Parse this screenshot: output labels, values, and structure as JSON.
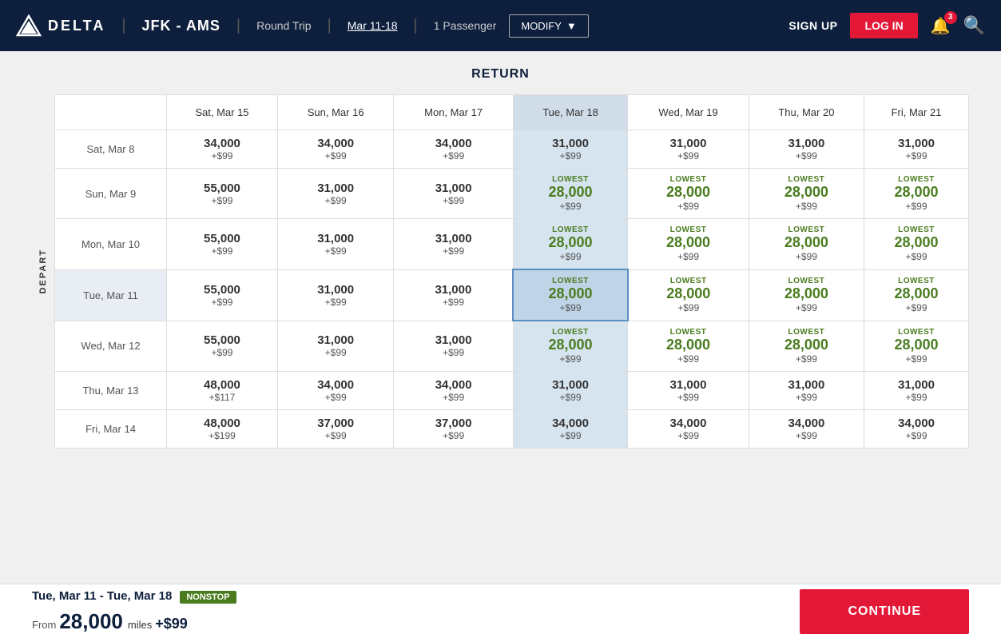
{
  "header": {
    "logo_text": "DELTA",
    "route": "JFK - AMS",
    "divider1": "|",
    "trip_type": "Round Trip",
    "divider2": "|",
    "dates": "Mar 11-18",
    "divider3": "|",
    "passengers": "1 Passenger",
    "modify_label": "MODIFY",
    "signup_label": "SIGN UP",
    "login_label": "LOG IN",
    "notif_count": "3"
  },
  "section_title": "RETURN",
  "depart_label": "DEPART",
  "columns": [
    {
      "id": "empty",
      "label": ""
    },
    {
      "id": "sat_mar15",
      "label": "Sat, Mar 15",
      "selected": false
    },
    {
      "id": "sun_mar16",
      "label": "Sun, Mar 16",
      "selected": false
    },
    {
      "id": "mon_mar17",
      "label": "Mon, Mar 17",
      "selected": false
    },
    {
      "id": "tue_mar18",
      "label": "Tue, Mar 18",
      "selected": true
    },
    {
      "id": "wed_mar19",
      "label": "Wed, Mar 19",
      "selected": false
    },
    {
      "id": "thu_mar20",
      "label": "Thu, Mar 20",
      "selected": false
    },
    {
      "id": "fri_mar21",
      "label": "Fri, Mar 21",
      "selected": false
    }
  ],
  "rows": [
    {
      "id": "sat_mar8",
      "label": "Sat, Mar 8",
      "selected": false,
      "cells": [
        {
          "miles": "34,000",
          "fee": "+$99",
          "lowest": false
        },
        {
          "miles": "34,000",
          "fee": "+$99",
          "lowest": false
        },
        {
          "miles": "34,000",
          "fee": "+$99",
          "lowest": false
        },
        {
          "miles": "31,000",
          "fee": "+$99",
          "lowest": false
        },
        {
          "miles": "31,000",
          "fee": "+$99",
          "lowest": false
        },
        {
          "miles": "31,000",
          "fee": "+$99",
          "lowest": false
        },
        {
          "miles": "31,000",
          "fee": "+$99",
          "lowest": false
        }
      ]
    },
    {
      "id": "sun_mar9",
      "label": "Sun, Mar 9",
      "selected": false,
      "cells": [
        {
          "miles": "55,000",
          "fee": "+$99",
          "lowest": false
        },
        {
          "miles": "31,000",
          "fee": "+$99",
          "lowest": false
        },
        {
          "miles": "31,000",
          "fee": "+$99",
          "lowest": false
        },
        {
          "miles": "28,000",
          "fee": "+$99",
          "lowest": true
        },
        {
          "miles": "28,000",
          "fee": "+$99",
          "lowest": true
        },
        {
          "miles": "28,000",
          "fee": "+$99",
          "lowest": true
        },
        {
          "miles": "28,000",
          "fee": "+$99",
          "lowest": true
        }
      ]
    },
    {
      "id": "mon_mar10",
      "label": "Mon, Mar 10",
      "selected": false,
      "cells": [
        {
          "miles": "55,000",
          "fee": "+$99",
          "lowest": false
        },
        {
          "miles": "31,000",
          "fee": "+$99",
          "lowest": false
        },
        {
          "miles": "31,000",
          "fee": "+$99",
          "lowest": false
        },
        {
          "miles": "28,000",
          "fee": "+$99",
          "lowest": true
        },
        {
          "miles": "28,000",
          "fee": "+$99",
          "lowest": true
        },
        {
          "miles": "28,000",
          "fee": "+$99",
          "lowest": true
        },
        {
          "miles": "28,000",
          "fee": "+$99",
          "lowest": true
        }
      ]
    },
    {
      "id": "tue_mar11",
      "label": "Tue, Mar 11",
      "selected": true,
      "cells": [
        {
          "miles": "55,000",
          "fee": "+$99",
          "lowest": false
        },
        {
          "miles": "31,000",
          "fee": "+$99",
          "lowest": false
        },
        {
          "miles": "31,000",
          "fee": "+$99",
          "lowest": false
        },
        {
          "miles": "28,000",
          "fee": "+$99",
          "lowest": true,
          "selected": true
        },
        {
          "miles": "28,000",
          "fee": "+$99",
          "lowest": true
        },
        {
          "miles": "28,000",
          "fee": "+$99",
          "lowest": true
        },
        {
          "miles": "28,000",
          "fee": "+$99",
          "lowest": true
        }
      ]
    },
    {
      "id": "wed_mar12",
      "label": "Wed, Mar 12",
      "selected": false,
      "cells": [
        {
          "miles": "55,000",
          "fee": "+$99",
          "lowest": false
        },
        {
          "miles": "31,000",
          "fee": "+$99",
          "lowest": false
        },
        {
          "miles": "31,000",
          "fee": "+$99",
          "lowest": false
        },
        {
          "miles": "28,000",
          "fee": "+$99",
          "lowest": true
        },
        {
          "miles": "28,000",
          "fee": "+$99",
          "lowest": true
        },
        {
          "miles": "28,000",
          "fee": "+$99",
          "lowest": true
        },
        {
          "miles": "28,000",
          "fee": "+$99",
          "lowest": true
        }
      ]
    },
    {
      "id": "thu_mar13",
      "label": "Thu, Mar 13",
      "selected": false,
      "cells": [
        {
          "miles": "48,000",
          "fee": "+$117",
          "lowest": false
        },
        {
          "miles": "34,000",
          "fee": "+$99",
          "lowest": false
        },
        {
          "miles": "34,000",
          "fee": "+$99",
          "lowest": false
        },
        {
          "miles": "31,000",
          "fee": "+$99",
          "lowest": false
        },
        {
          "miles": "31,000",
          "fee": "+$99",
          "lowest": false
        },
        {
          "miles": "31,000",
          "fee": "+$99",
          "lowest": false
        },
        {
          "miles": "31,000",
          "fee": "+$99",
          "lowest": false
        }
      ]
    },
    {
      "id": "fri_mar14",
      "label": "Fri, Mar 14",
      "selected": false,
      "cells": [
        {
          "miles": "48,000",
          "fee": "+$199",
          "lowest": false
        },
        {
          "miles": "37,000",
          "fee": "+$99",
          "lowest": false
        },
        {
          "miles": "37,000",
          "fee": "+$99",
          "lowest": false
        },
        {
          "miles": "34,000",
          "fee": "+$99",
          "lowest": false
        },
        {
          "miles": "34,000",
          "fee": "+$99",
          "lowest": false
        },
        {
          "miles": "34,000",
          "fee": "+$99",
          "lowest": false
        },
        {
          "miles": "34,000",
          "fee": "+$99",
          "lowest": false
        }
      ]
    }
  ],
  "footer": {
    "trip_dates": "Tue, Mar 11 - Tue, Mar 18",
    "nonstop_label": "NONSTOP",
    "from_label": "From",
    "miles": "28,000",
    "miles_label": "miles",
    "fee": "+$99",
    "continue_label": "CONTINUE"
  }
}
